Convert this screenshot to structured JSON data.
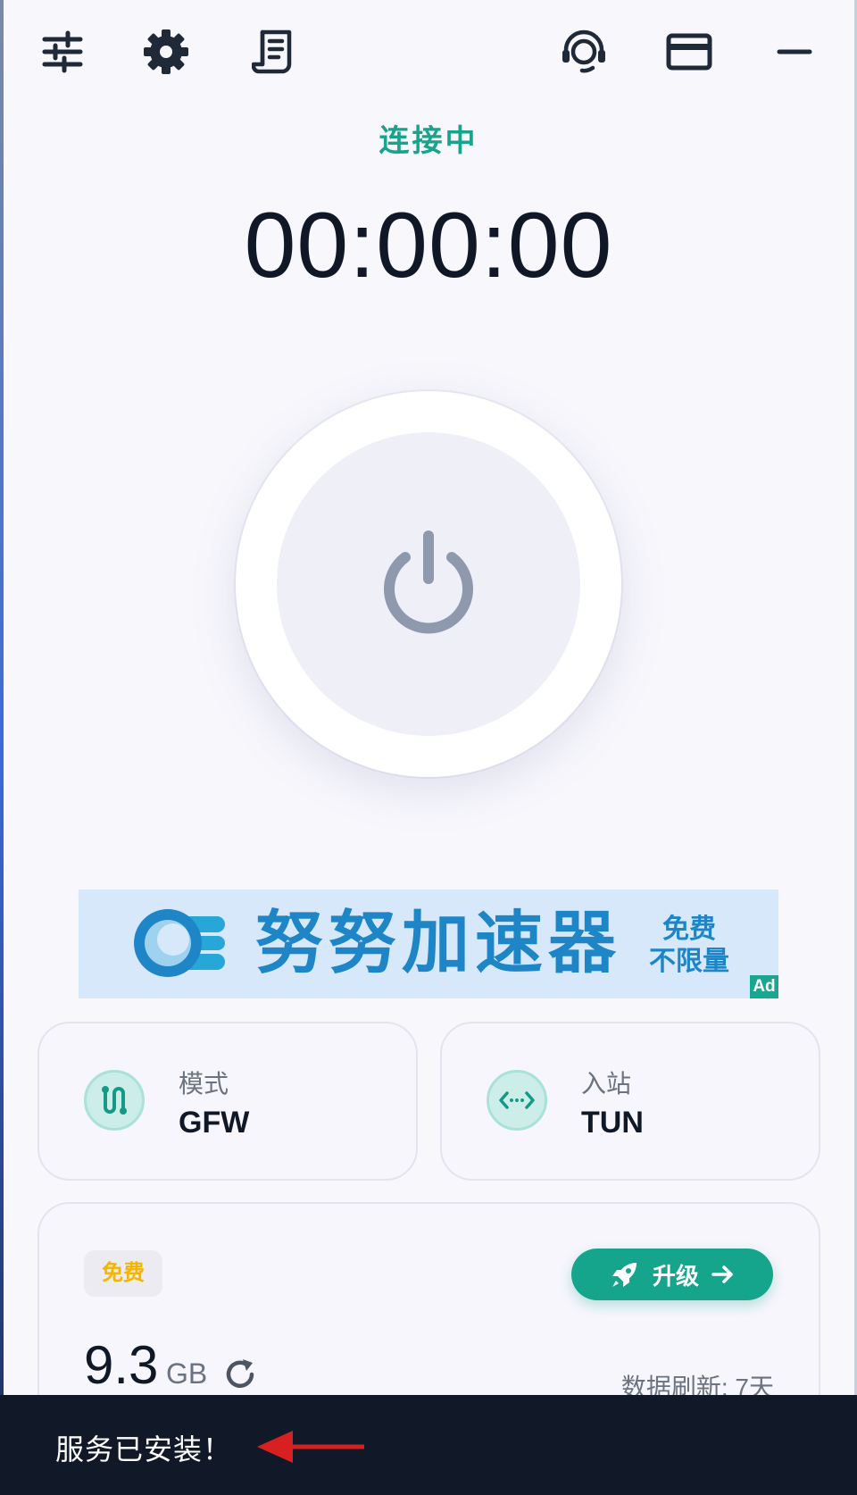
{
  "header": {
    "icons": [
      "sliders-icon",
      "gear-icon",
      "log-document-icon",
      "support-headset-icon",
      "billing-card-icon",
      "minimize-icon"
    ]
  },
  "status": {
    "label": "连接中",
    "timer": "00:00:00"
  },
  "ad": {
    "title": "努努加速器",
    "subtitle_line1": "免费",
    "subtitle_line2": "不限量",
    "tag": "Ad"
  },
  "mode_card": {
    "label": "模式",
    "value": "GFW"
  },
  "inbound_card": {
    "label": "入站",
    "value": "TUN"
  },
  "plan": {
    "badge": "免费",
    "upgrade_label": "升级",
    "data_amount": "9.3",
    "data_unit": "GB",
    "refresh_label": "数据刷新: 7天"
  },
  "toast": {
    "message": "服务已安装！"
  },
  "colors": {
    "accent": "#18a38c",
    "background": "#f7f7fc",
    "toast_bg": "#111827",
    "ad_text": "#1e86c7",
    "badge_text": "#f5b400"
  }
}
